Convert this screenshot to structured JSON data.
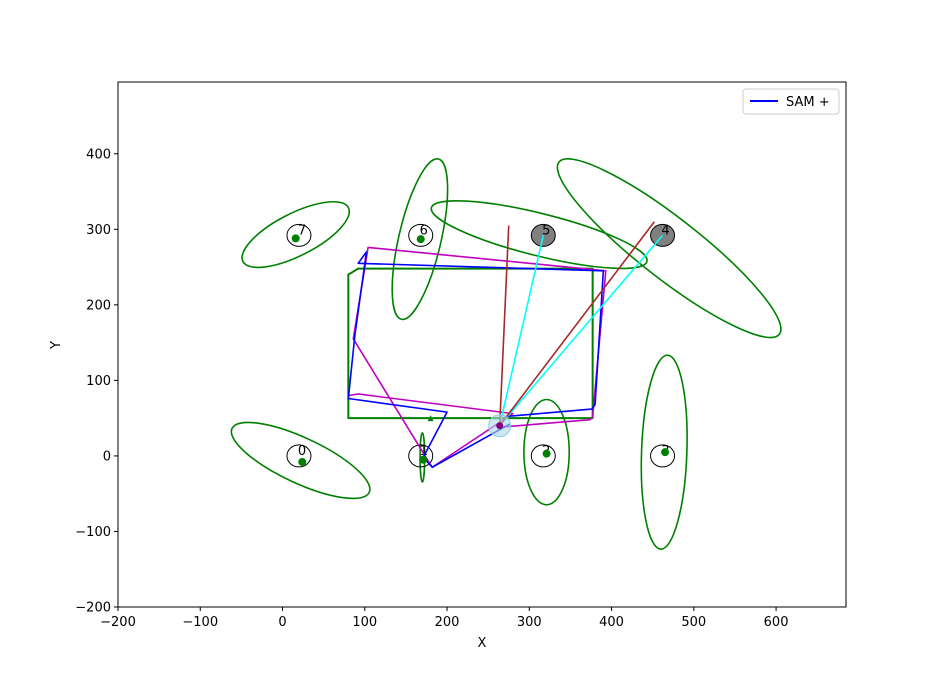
{
  "chart_data": {
    "type": "line",
    "xlabel": "X",
    "ylabel": "Y",
    "xlim": [
      -200,
      685
    ],
    "ylim": [
      -200,
      495
    ],
    "xticks": [
      -200,
      -100,
      0,
      100,
      200,
      300,
      400,
      500,
      600
    ],
    "yticks": [
      -200,
      -100,
      0,
      100,
      200,
      300,
      400
    ],
    "grid": false,
    "legend": {
      "placement": "top-right",
      "entries": [
        {
          "label": "SAM +",
          "color": "#0000ff"
        }
      ]
    },
    "landmarks": [
      {
        "label": "0",
        "x": 20,
        "y": 0,
        "seen": false,
        "est": [
          24,
          -8
        ]
      },
      {
        "label": "1",
        "x": 168,
        "y": 0,
        "seen": false,
        "est": [
          171,
          -5
        ]
      },
      {
        "label": "2",
        "x": 317,
        "y": 0,
        "seen": false,
        "est": [
          321,
          3
        ]
      },
      {
        "label": "3",
        "x": 462,
        "y": 0,
        "seen": false,
        "est": [
          465,
          5
        ]
      },
      {
        "label": "4",
        "x": 462,
        "y": 292,
        "seen": true,
        "est": null
      },
      {
        "label": "5",
        "x": 317,
        "y": 292,
        "seen": true,
        "est": null
      },
      {
        "label": "6",
        "x": 168,
        "y": 292,
        "seen": false,
        "est": [
          168,
          287
        ]
      },
      {
        "label": "7",
        "x": 20,
        "y": 292,
        "seen": false,
        "est": [
          16,
          288
        ]
      }
    ],
    "series": [
      {
        "role": "ground-truth path",
        "color": "#008000",
        "x": [
          180,
          80,
          80,
          92,
          377,
          377,
          180
        ],
        "y": [
          50,
          50,
          240,
          248,
          248,
          50,
          50
        ]
      },
      {
        "name": "SAM +",
        "color": "#0000ff",
        "x": [
          270,
          376,
          380,
          390,
          92,
          102,
          88,
          80,
          200,
          171,
          182,
          276
        ],
        "y": [
          52,
          62,
          68,
          245,
          255,
          270,
          160,
          76,
          58,
          -2,
          -15,
          42
        ]
      },
      {
        "role": "odometry path",
        "color": "#bf00bf",
        "x": [
          264,
          374,
          377,
          393,
          104,
          86,
          175,
          182,
          280,
          92,
          80,
          80
        ],
        "y": [
          38,
          48,
          52,
          245,
          276,
          155,
          -3,
          -15,
          56,
          82,
          80,
          78
        ]
      }
    ],
    "robot": {
      "x": 264,
      "y": 40
    },
    "observation_rays": [
      {
        "color": "#00ffff",
        "to": [
          317,
          292
        ]
      },
      {
        "color": "#00ffff",
        "to": [
          462,
          292
        ]
      },
      {
        "color": "#a52a2a",
        "to": [
          275,
          305
        ]
      },
      {
        "color": "#a52a2a",
        "to": [
          452,
          310
        ]
      }
    ],
    "covariance_ellipses": [
      {
        "cx": 22,
        "cy": -6,
        "rx": 92,
        "ry": 30,
        "angle": -25
      },
      {
        "cx": 170,
        "cy": -2,
        "rx": 30,
        "ry": 3,
        "angle": 90
      },
      {
        "cx": 321,
        "cy": 5,
        "rx": 64,
        "ry": 30,
        "angle": 90
      },
      {
        "cx": 464,
        "cy": 5,
        "rx": 118,
        "ry": 30,
        "angle": 88
      },
      {
        "cx": 470,
        "cy": 275,
        "rx": 170,
        "ry": 40,
        "angle": -38
      },
      {
        "cx": 312,
        "cy": 293,
        "rx": 135,
        "ry": 28,
        "angle": -14
      },
      {
        "cx": 167,
        "cy": 287,
        "rx": 100,
        "ry": 28,
        "angle": 77
      },
      {
        "cx": 16,
        "cy": 293,
        "rx": 72,
        "ry": 28,
        "angle": 27
      }
    ]
  }
}
